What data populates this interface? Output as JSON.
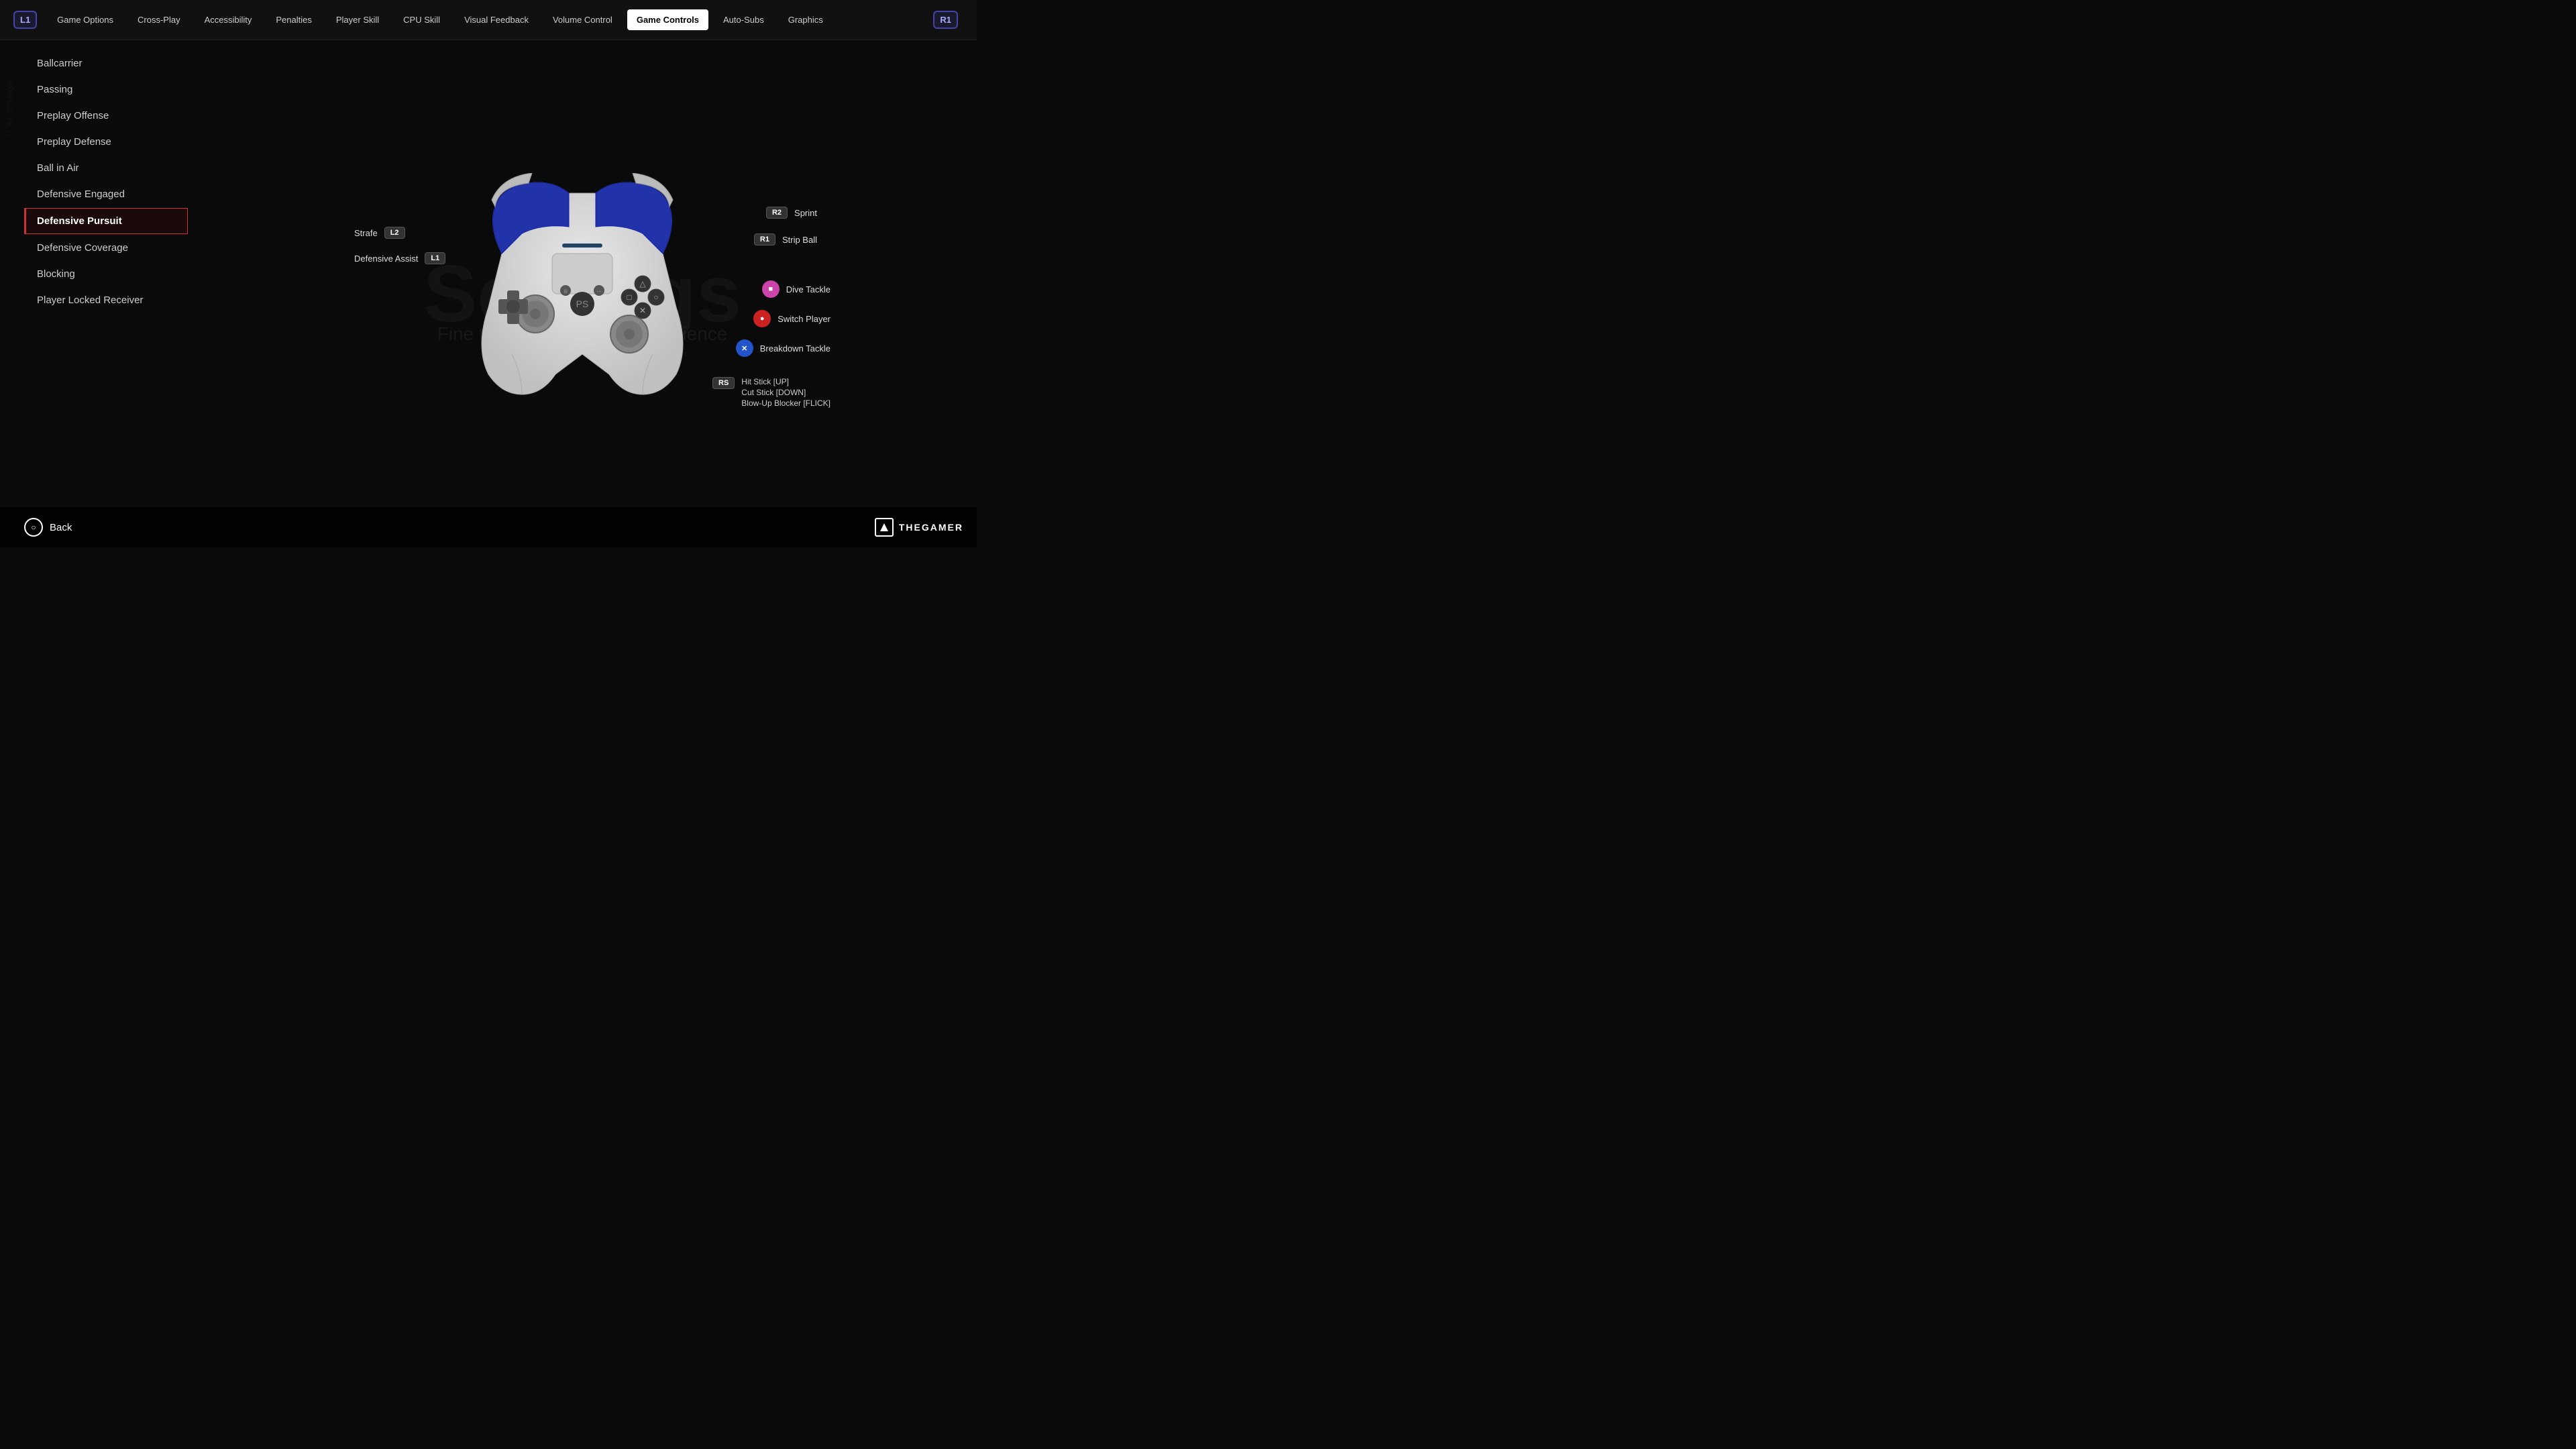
{
  "side_label": "// SETTINGS",
  "nav": {
    "left_badge": "L1",
    "right_badge": "R1",
    "items": [
      {
        "label": "Game Options",
        "active": false
      },
      {
        "label": "Cross-Play",
        "active": false
      },
      {
        "label": "Accessibility",
        "active": false
      },
      {
        "label": "Penalties",
        "active": false
      },
      {
        "label": "Player Skill",
        "active": false
      },
      {
        "label": "CPU Skill",
        "active": false
      },
      {
        "label": "Visual Feedback",
        "active": false
      },
      {
        "label": "Volume Control",
        "active": false
      },
      {
        "label": "Game Controls",
        "active": true
      },
      {
        "label": "Auto-Subs",
        "active": false
      },
      {
        "label": "Graphics",
        "active": false
      }
    ]
  },
  "menu": {
    "items": [
      {
        "label": "Ballcarrier",
        "active": false
      },
      {
        "label": "Passing",
        "active": false
      },
      {
        "label": "Preplay Offense",
        "active": false
      },
      {
        "label": "Preplay Defense",
        "active": false
      },
      {
        "label": "Ball in Air",
        "active": false
      },
      {
        "label": "Defensive Engaged",
        "active": false
      },
      {
        "label": "Defensive Pursuit",
        "active": true
      },
      {
        "label": "Defensive Coverage",
        "active": false
      },
      {
        "label": "Blocking",
        "active": false
      },
      {
        "label": "Player Locked Receiver",
        "active": false
      }
    ]
  },
  "bg_text": "Settings",
  "bg_subtitle": "Fine tune your Madden experience",
  "controller": {
    "left_labels": [
      {
        "badge": "L2",
        "text": "Strafe"
      },
      {
        "badge": "L1",
        "text": "Defensive Assist"
      }
    ],
    "right_labels": [
      {
        "badge": "R2",
        "text": "Sprint"
      },
      {
        "badge": "R1",
        "text": "Strip Ball"
      }
    ],
    "action_labels": [
      {
        "icon": "pink",
        "label": "Dive Tackle"
      },
      {
        "icon": "red",
        "label": "Switch Player"
      },
      {
        "icon": "blue",
        "label": "Breakdown Tackle"
      }
    ],
    "rs_label": {
      "badge": "RS",
      "lines": [
        "Hit Stick [UP]",
        "Cut Stick [DOWN]",
        "Blow-Up Blocker [FLICK]"
      ]
    }
  },
  "bottom": {
    "back_label": "Back"
  },
  "brand": "THEGAMER"
}
